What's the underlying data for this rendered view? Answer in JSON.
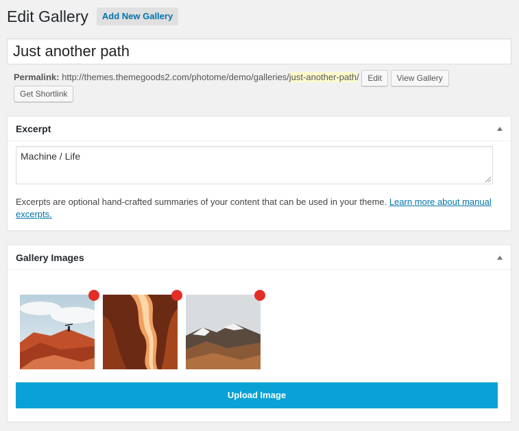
{
  "page": {
    "title": "Edit Gallery",
    "add_new_label": "Add New Gallery"
  },
  "post": {
    "title": "Just another path",
    "permalink_label": "Permalink:",
    "permalink_base": "http://themes.themegoods2.com/photome/demo/galleries/",
    "permalink_slug": "just-another-path",
    "permalink_trailing": "/",
    "edit_label": "Edit",
    "view_label": "View Gallery",
    "shortlink_label": "Get Shortlink"
  },
  "excerpt": {
    "heading": "Excerpt",
    "value": "Machine / Life",
    "help_text": "Excerpts are optional hand-crafted summaries of your content that can be used in your theme. ",
    "help_link": "Learn more about manual excerpts."
  },
  "gallery": {
    "heading": "Gallery Images",
    "images": [
      {
        "name": "red-rocks-hiker",
        "icon": "image-thumbnail"
      },
      {
        "name": "antelope-canyon",
        "icon": "image-thumbnail"
      },
      {
        "name": "snowy-mountains",
        "icon": "image-thumbnail"
      }
    ],
    "upload_label": "Upload Image"
  },
  "colors": {
    "accent": "#0073aa",
    "upload_button": "#0aa2d6",
    "remove_dot": "#e52d27",
    "slug_highlight": "#fffbcc"
  }
}
